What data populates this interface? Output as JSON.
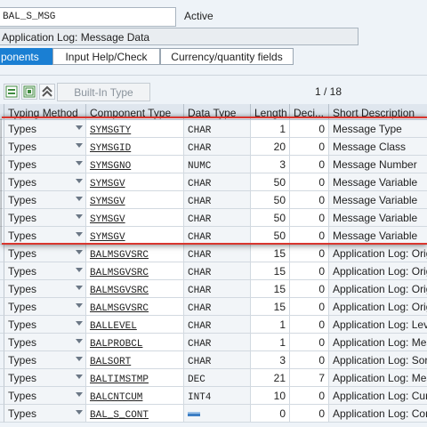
{
  "structure": {
    "name": "BAL_S_MSG",
    "status": "Active",
    "description": "Application Log: Message Data"
  },
  "tabs": [
    {
      "label": "ponents"
    },
    {
      "label": "Input Help/Check"
    },
    {
      "label": "Currency/quantity fields"
    }
  ],
  "toolbar": {
    "icons": [
      "insert-row-icon",
      "delete-row-icon",
      "move-up-icon"
    ],
    "builtin_label": "Built-In Type",
    "page_indicator": "1 / 18"
  },
  "table": {
    "headers": [
      "Typing Method",
      "Component Type",
      "Data Type",
      "Length",
      "Deci...",
      "Short Description"
    ],
    "rows": [
      {
        "method": "Types",
        "type": "SYMSGTY",
        "dtype": "CHAR",
        "length": "1",
        "decimals": "0",
        "desc": "Message Type"
      },
      {
        "method": "Types",
        "type": "SYMSGID",
        "dtype": "CHAR",
        "length": "20",
        "decimals": "0",
        "desc": "Message Class"
      },
      {
        "method": "Types",
        "type": "SYMSGNO",
        "dtype": "NUMC",
        "length": "3",
        "decimals": "0",
        "desc": "Message Number"
      },
      {
        "method": "Types",
        "type": "SYMSGV",
        "dtype": "CHAR",
        "length": "50",
        "decimals": "0",
        "desc": "Message Variable"
      },
      {
        "method": "Types",
        "type": "SYMSGV",
        "dtype": "CHAR",
        "length": "50",
        "decimals": "0",
        "desc": "Message Variable"
      },
      {
        "method": "Types",
        "type": "SYMSGV",
        "dtype": "CHAR",
        "length": "50",
        "decimals": "0",
        "desc": "Message Variable"
      },
      {
        "method": "Types",
        "type": "SYMSGV",
        "dtype": "CHAR",
        "length": "50",
        "decimals": "0",
        "desc": "Message Variable"
      },
      {
        "method": "Types",
        "type": "BALMSGVSRC",
        "dtype": "CHAR",
        "length": "15",
        "decimals": "0",
        "desc": "Application Log: Orig"
      },
      {
        "method": "Types",
        "type": "BALMSGVSRC",
        "dtype": "CHAR",
        "length": "15",
        "decimals": "0",
        "desc": "Application Log: Orig"
      },
      {
        "method": "Types",
        "type": "BALMSGVSRC",
        "dtype": "CHAR",
        "length": "15",
        "decimals": "0",
        "desc": "Application Log: Orig"
      },
      {
        "method": "Types",
        "type": "BALMSGVSRC",
        "dtype": "CHAR",
        "length": "15",
        "decimals": "0",
        "desc": "Application Log: Orig"
      },
      {
        "method": "Types",
        "type": "BALLEVEL",
        "dtype": "CHAR",
        "length": "1",
        "decimals": "0",
        "desc": "Application Log: Leve"
      },
      {
        "method": "Types",
        "type": "BALPROBCL",
        "dtype": "CHAR",
        "length": "1",
        "decimals": "0",
        "desc": "Application Log: Mess"
      },
      {
        "method": "Types",
        "type": "BALSORT",
        "dtype": "CHAR",
        "length": "3",
        "decimals": "0",
        "desc": "Application Log: Sort"
      },
      {
        "method": "Types",
        "type": "BALTIMSTMP",
        "dtype": "DEC",
        "length": "21",
        "decimals": "7",
        "desc": "Application Log: Mess"
      },
      {
        "method": "Types",
        "type": "BALCNTCUM",
        "dtype": "INT4",
        "length": "10",
        "decimals": "0",
        "desc": "Application Log: Cum"
      },
      {
        "method": "Types",
        "type": "BAL_S_CONT",
        "dtype": "",
        "length": "0",
        "decimals": "0",
        "desc": "Application Log: Cont"
      }
    ]
  },
  "colors": {
    "selected_tab": "#1a7fd3",
    "selection_border": "#d9362e",
    "header_bg": "#dfe6ee"
  }
}
